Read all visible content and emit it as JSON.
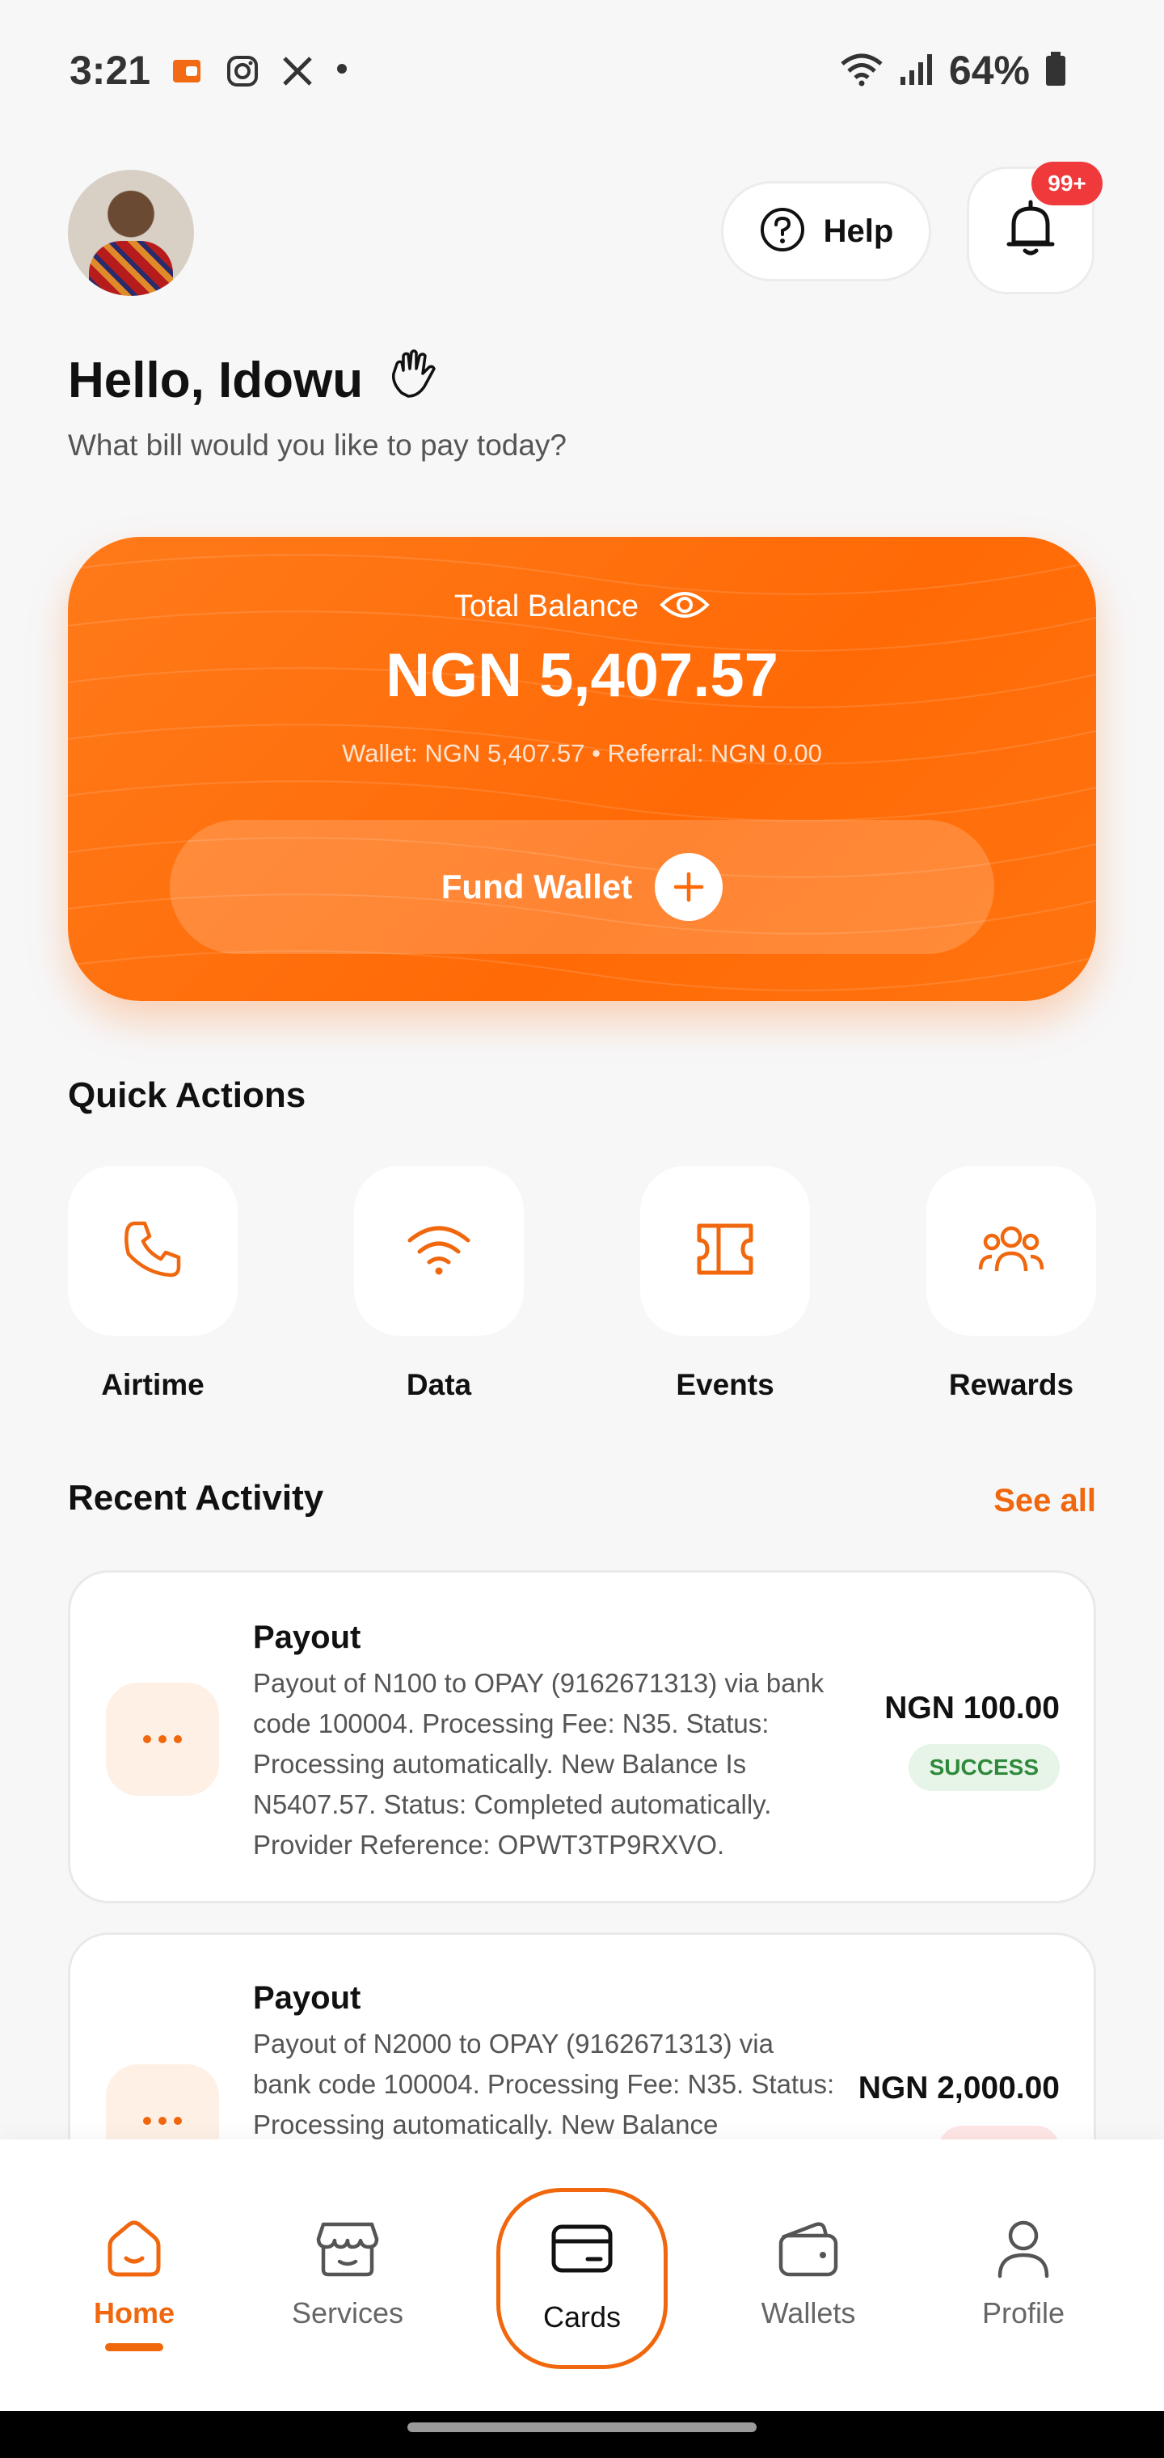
{
  "status_bar": {
    "time": "3:21",
    "battery": "64%",
    "left_icons": [
      "wallet-app-icon",
      "instagram-icon",
      "x-icon",
      "dot-icon"
    ],
    "right_icons": [
      "wifi-icon",
      "signal-icon",
      "battery-icon"
    ]
  },
  "header": {
    "help_label": "Help",
    "notification_badge": "99+"
  },
  "greeting": {
    "title": "Hello, Idowu",
    "subtitle": "What bill would you like to pay today?"
  },
  "balance": {
    "label": "Total Balance",
    "amount": "NGN 5,407.57",
    "breakdown": "Wallet: NGN 5,407.57  •  Referral: NGN 0.00",
    "fund_label": "Fund Wallet"
  },
  "quick_actions": {
    "title": "Quick Actions",
    "items": [
      {
        "label": "Airtime",
        "icon": "phone-icon"
      },
      {
        "label": "Data",
        "icon": "wifi-icon"
      },
      {
        "label": "Events",
        "icon": "ticket-icon"
      },
      {
        "label": "Rewards",
        "icon": "users-icon"
      }
    ]
  },
  "recent_activity": {
    "title": "Recent Activity",
    "see_all": "See all",
    "items": [
      {
        "title": "Payout",
        "desc": "Payout of N100 to OPAY (9162671313) via bank code 100004. Processing Fee: N35. Status: Processing automatically. New Balance Is N5407.57. Status: Completed automatically. Provider Reference: OPWT3TP9RXVO.",
        "amount": "NGN 100.00",
        "status": "SUCCESS"
      },
      {
        "title": "Payout",
        "desc": "Payout of N2000 to OPAY (9162671313) via bank code 100004. Processing Fee: N35. Status: Processing automatically. New Balance",
        "amount": "NGN 2,000.00"
      }
    ]
  },
  "bottom_nav": {
    "items": [
      {
        "label": "Home",
        "icon": "home-icon"
      },
      {
        "label": "Services",
        "icon": "store-icon"
      },
      {
        "label": "Cards",
        "icon": "card-icon"
      },
      {
        "label": "Wallets",
        "icon": "wallet-icon"
      },
      {
        "label": "Profile",
        "icon": "user-icon"
      }
    ]
  },
  "colors": {
    "accent": "#f0670d",
    "card_orange": "#ff6a06",
    "success_bg": "#e7f4e8",
    "success_text": "#2e8a3a",
    "badge_red": "#f0393b"
  }
}
